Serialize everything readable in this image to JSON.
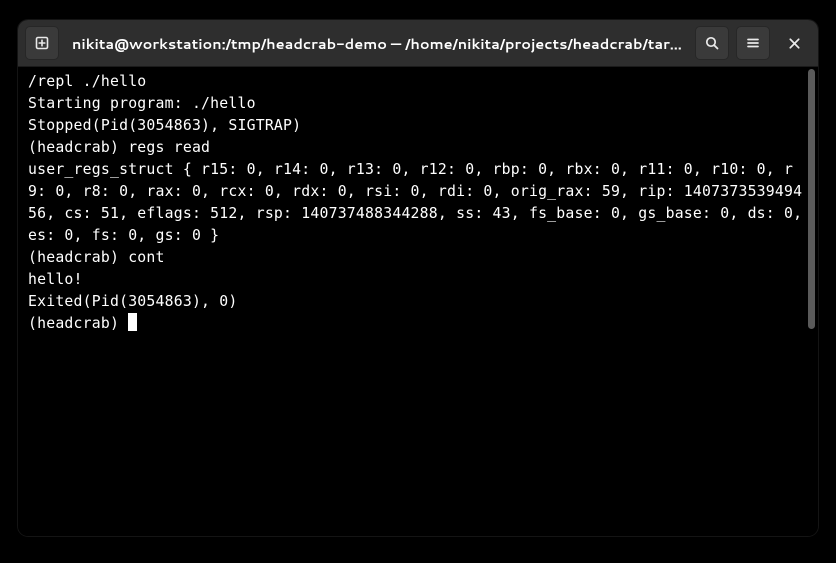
{
  "window": {
    "title": "nikita@workstation:/tmp/headcrab-demo — /home/nikita/projects/headcrab/tar…"
  },
  "icons": {
    "new_tab": "new-tab",
    "search": "search",
    "menu": "hamburger",
    "close": "close"
  },
  "terminal": {
    "lines": [
      "/repl ./hello",
      "Starting program: ./hello",
      "Stopped(Pid(3054863), SIGTRAP)",
      "(headcrab) regs read",
      "user_regs_struct { r15: 0, r14: 0, r13: 0, r12: 0, rbp: 0, rbx: 0, r11: 0, r10: 0, r9: 0, r8: 0, rax: 0, rcx: 0, rdx: 0, rsi: 0, rdi: 0, orig_rax: 59, rip: 140737353949456, cs: 51, eflags: 512, rsp: 140737488344288, ss: 43, fs_base: 0, gs_base: 0, ds: 0, es: 0, fs: 0, gs: 0 }",
      "(headcrab) cont",
      "hello!",
      "Exited(Pid(3054863), 0)"
    ],
    "prompt": "(headcrab) "
  }
}
